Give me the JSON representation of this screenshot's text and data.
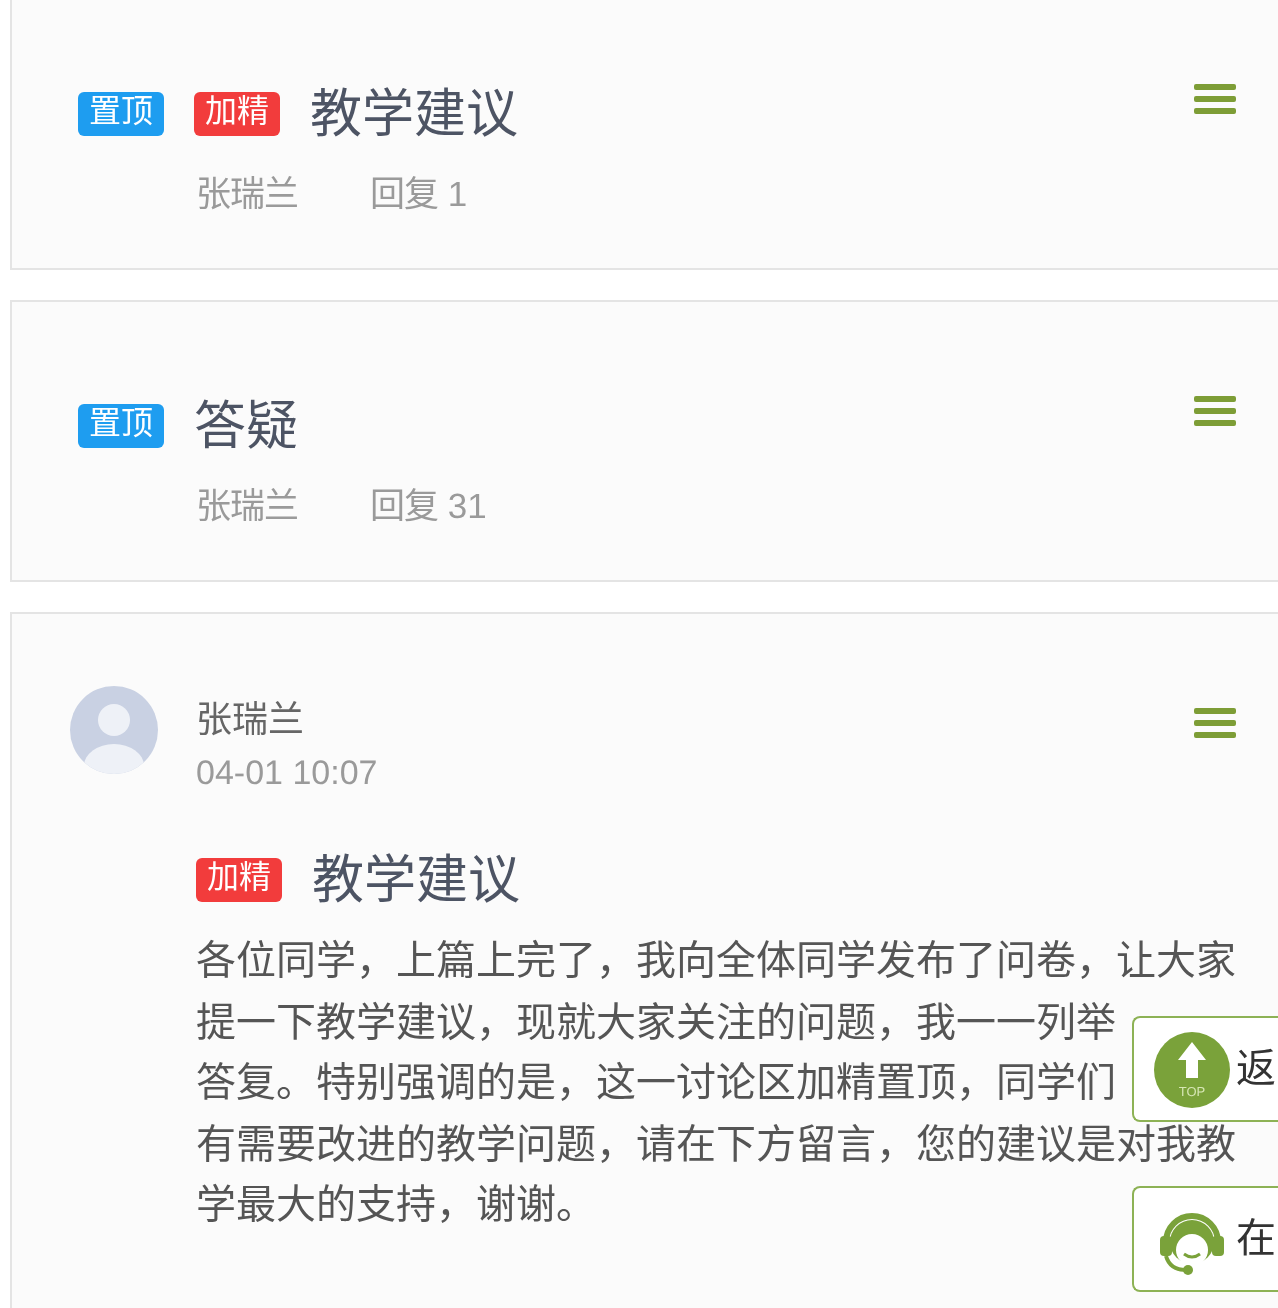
{
  "topics": [
    {
      "kind": "summary",
      "tags": [
        {
          "label": "置顶",
          "color": "#1e9df0"
        },
        {
          "label": "加精",
          "color": "#f23c3c"
        }
      ],
      "title": "教学建议",
      "author": "张瑞兰",
      "replies": "回复 1"
    },
    {
      "kind": "summary",
      "tags": [
        {
          "label": "置顶",
          "color": "#1e9df0"
        }
      ],
      "title": "答疑",
      "author": "张瑞兰",
      "replies": "回复 31"
    },
    {
      "kind": "post",
      "author": "张瑞兰",
      "time": "04-01 10:07",
      "tags": [
        {
          "label": "加精",
          "color": "#f23c3c"
        }
      ],
      "title": "教学建议",
      "body_lines": [
        "各位同学，上篇上完了，我向全体同学发布了问卷，让大家",
        "提一下教学建议，现就大家关注的问题，我一一列举",
        "答复。特别强调的是，这一讨论区加精置顶，同学们",
        "有需要改进的教学问题，请在下方留言，您的建议是对我教",
        "学最大的支持，谢谢。"
      ]
    }
  ],
  "float_buttons": [
    {
      "kind": "top",
      "icon_text": "TOP",
      "label": "返"
    },
    {
      "kind": "service",
      "label": "在"
    }
  ]
}
